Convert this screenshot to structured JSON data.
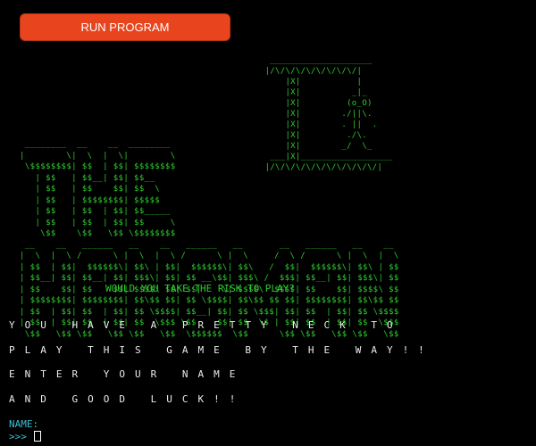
{
  "toolbar": {
    "run_label": "RUN PROGRAM"
  },
  "ascii_art": {
    "gallows": "      ____________________\n     |/\\/\\/\\/\\/\\/\\/\\/\\/|\n         |X|           |\n         |X|          _|_\n         |X|         (o_O)\n         |X|        ./||\\.\n         |X|        . ||  .\n         |X|         ./\\.\n         |X|        _/  \\_\n      ___|X|__________________\n     |/\\/\\/\\/\\/\\/\\/\\/\\/\\/\\/|",
    "title": " ________  __    __  ________  \n|        \\|  \\  |  \\|        \\ \n \\$$$$$$$$| $$  | $$| $$$$$$$$ \n   | $$   | $$__| $$| $$__     \n   | $$   | $$    $$| $$  \\    \n   | $$   | $$$$$$$$| $$$$$    \n   | $$   | $$  | $$| $$_____  \n   | $$   | $$  | $$| $$     \\ \n    \\$$    \\$$   \\$$ \\$$$$$$$$ \n __    __   ______   __    __   ______   __       __   ______   __    __ \n|  \\  |  \\ /      \\ |  \\  |  \\ /      \\ |  \\     /  \\ /      \\ |  \\  |  \\\n| $$  | $$|  $$$$$$\\| $$\\ | $$|  $$$$$$\\| $$\\   /  $$|  $$$$$$\\| $$\\ | $$\n| $$__| $$| $$__| $$| $$$\\| $$| $$ __\\$$| $$$\\ /  $$$| $$__| $$| $$$\\| $$\n| $$    $$| $$    $$| $$$$\\ $$| $$|    \\| $$$$\\  $$$$| $$    $$| $$$$\\ $$\n| $$$$$$$$| $$$$$$$$| $$\\$$ $$| $$ \\$$$$| $$\\$$ $$ $$| $$$$$$$$| $$\\$$ $$\n| $$  | $$| $$  | $$| $$ \\$$$$| $$__| $$| $$ \\$$$| $$| $$  | $$| $$ \\$$$$\n| $$  | $$| $$  | $$| $$  \\$$$ \\$$    $$| $$  \\$ | $$| $$  | $$| $$  \\$$$\n \\$$   \\$$ \\$$   \\$$ \\$$   \\$$  \\$$$$$$  \\$$      \\$$ \\$$   \\$$ \\$$   \\$$"
  },
  "tagline": "WOULD YOU TAKE THE RISK TO PLAY?",
  "messages": [
    "YOU HAVE A PRETTY NECK TO",
    "PLAY THIS GAME BY THE WAY!!",
    "ENTER YOUR NAME",
    "AND GOOD LUCK!!"
  ],
  "prompt": {
    "label": "NAME:",
    "arrows": ">>>"
  },
  "colors": {
    "background": "#000000",
    "button": "#e8451e",
    "ascii_green": "#2ecc2e",
    "message_text": "#ececec",
    "prompt_cyan": "#39c0d4"
  },
  "icons": {
    "cursor": "text-cursor-block"
  }
}
